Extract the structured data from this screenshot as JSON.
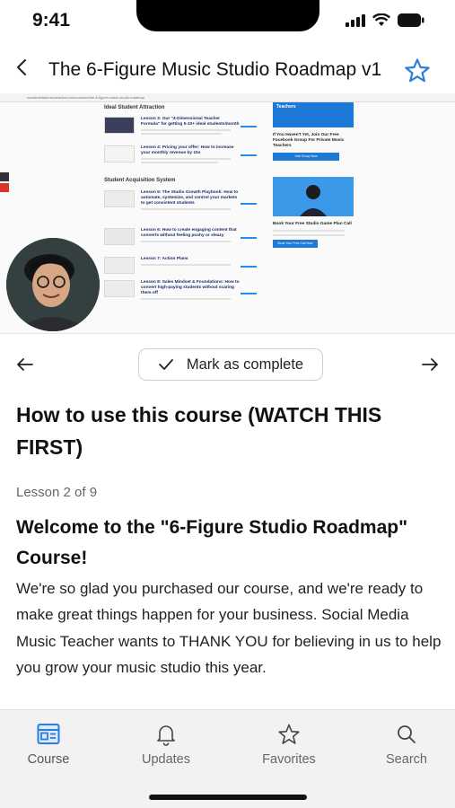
{
  "status_bar": {
    "time": "9:41"
  },
  "header": {
    "title": "The 6-Figure Music Studio Roadmap v1"
  },
  "video": {
    "url": "socialmediamusicteacher.com/courses/the-6-figure-music-studio-roadmap",
    "sections": [
      "Ideal Student Attraction",
      "Student Acquisition System"
    ],
    "lessons": [
      "Lesson 3: Our \"4-Dimensional Teacher Formula\" for getting 5-10+ ideal students/month",
      "Lesson 4: Pricing your offer: How to increase your monthly revenue by 15x",
      "Lesson 5: The Studio Growth Playbook: How to automate, systemize, and control your markets to get consistent students",
      "Lesson 6: How to create engaging content that converts without feeling pushy or sleazy",
      "Lesson 7: Action Plans",
      "Lesson 8: Sales Mindset & Foundations: How to convert high-paying students without scaring them off"
    ],
    "promo": {
      "banner": "Teachers",
      "facebook_head": "If You Haven't Yet, Join Our Free Facebook Group For Private Music Teachers",
      "facebook_btn": "Visit Group Now",
      "call_head": "Book Your Free Studio Game Plan Call",
      "call_btn": "Book Your Free Call Now"
    }
  },
  "lesson_nav": {
    "complete_label": "Mark as complete"
  },
  "content": {
    "lesson_title": "How to use this course (WATCH THIS FIRST)",
    "lesson_count": "Lesson 2 of 9",
    "welcome_heading": "Welcome to the \"6-Figure Studio Roadmap\" Course!",
    "body": "We're so glad you purchased our course, and we're ready to make great things happen for your business. Social Media Music Teacher wants to THANK YOU for believing in us to help you grow your music studio this year."
  },
  "tabs": [
    {
      "label": "Course",
      "icon": "course-icon",
      "active": true
    },
    {
      "label": "Updates",
      "icon": "bell-icon",
      "active": false
    },
    {
      "label": "Favorites",
      "icon": "star-icon",
      "active": false
    },
    {
      "label": "Search",
      "icon": "search-icon",
      "active": false
    }
  ],
  "colors": {
    "accent": "#2a8be0",
    "text": "#111111",
    "muted": "#666666",
    "tab_bg": "#f2f2f2"
  }
}
